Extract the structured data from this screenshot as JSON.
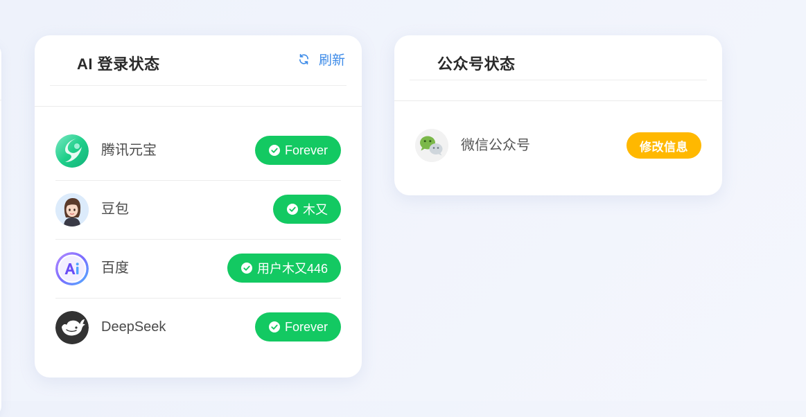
{
  "ai_card": {
    "title": "AI 登录状态",
    "refresh_label": "刷新",
    "rows": [
      {
        "name": "腾讯元宝",
        "status": "Forever"
      },
      {
        "name": "豆包",
        "status": "木又"
      },
      {
        "name": "百度",
        "status": "用户木又446"
      },
      {
        "name": "DeepSeek",
        "status": "Forever"
      }
    ]
  },
  "mp_card": {
    "title": "公众号状态",
    "rows": [
      {
        "name": "微信公众号",
        "action": "修改信息"
      }
    ]
  },
  "icons": {
    "refresh": "refresh-icon",
    "check": "check-circle-icon",
    "yuanbao": "yuanbao-logo-icon",
    "doubao": "doubao-avatar-icon",
    "baidu": "baidu-ai-logo-icon",
    "deepseek": "deepseek-whale-icon",
    "wechat": "wechat-icon"
  },
  "colors": {
    "success": "#13c962",
    "warning": "#ffb800",
    "link": "#3d8be8"
  }
}
